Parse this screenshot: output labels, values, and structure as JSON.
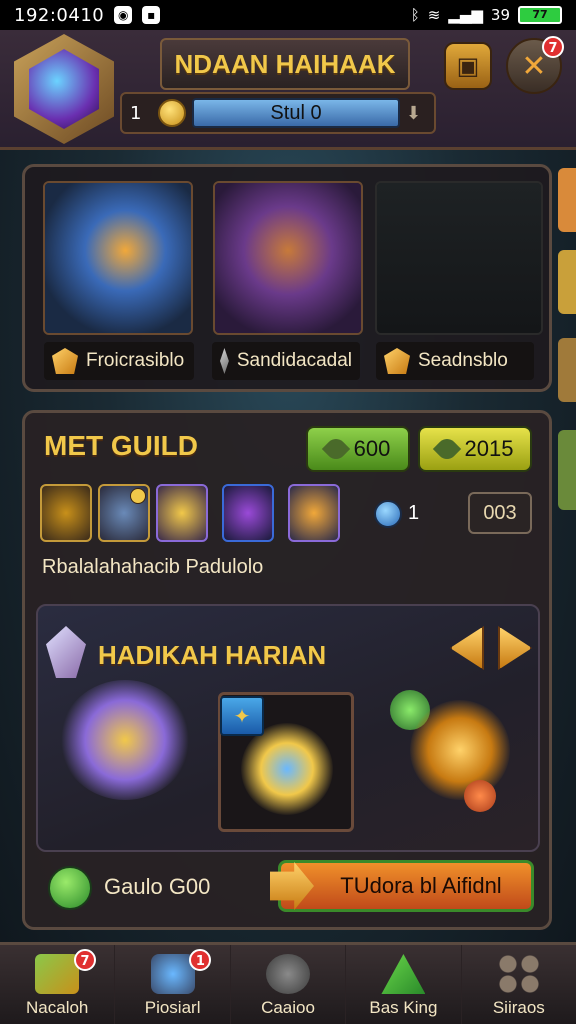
{
  "status_bar": {
    "time": "192:0410",
    "battery": "77",
    "signal_text": "39"
  },
  "header": {
    "title": "NDAAN HAIHAAK",
    "level": "1",
    "currency_value": "Stul 0",
    "close_badge": "7"
  },
  "heroes": [
    {
      "name": "Froicrasiblo",
      "gem": "orange-gem-icon"
    },
    {
      "name": "Sandidacadal",
      "gem": "grey-gem-icon"
    },
    {
      "name": "Seadnsblo",
      "gem": "orange-gem-icon"
    }
  ],
  "guild": {
    "title": "MET GUILD",
    "resource_green": "600",
    "resource_yellow": "2015",
    "orb_count": "1",
    "box_value": "003",
    "subtitle": "Rbalalahahacib Padulolo"
  },
  "quest": {
    "title": "HADIKAH HARIAN",
    "gold_label": "Gaulo G00",
    "action_label": "TUdora bl Aifidnl"
  },
  "bottom_nav": [
    {
      "label": "Nacaloh",
      "badge": "7"
    },
    {
      "label": "Piosiarl",
      "badge": "1"
    },
    {
      "label": "Caaioo",
      "badge": ""
    },
    {
      "label": "Bas King",
      "badge": ""
    },
    {
      "label": "Siiraos",
      "badge": ""
    }
  ],
  "colors": {
    "accent_gold": "#f1c84a",
    "panel": "#28221f",
    "green": "#4a8a1a"
  }
}
